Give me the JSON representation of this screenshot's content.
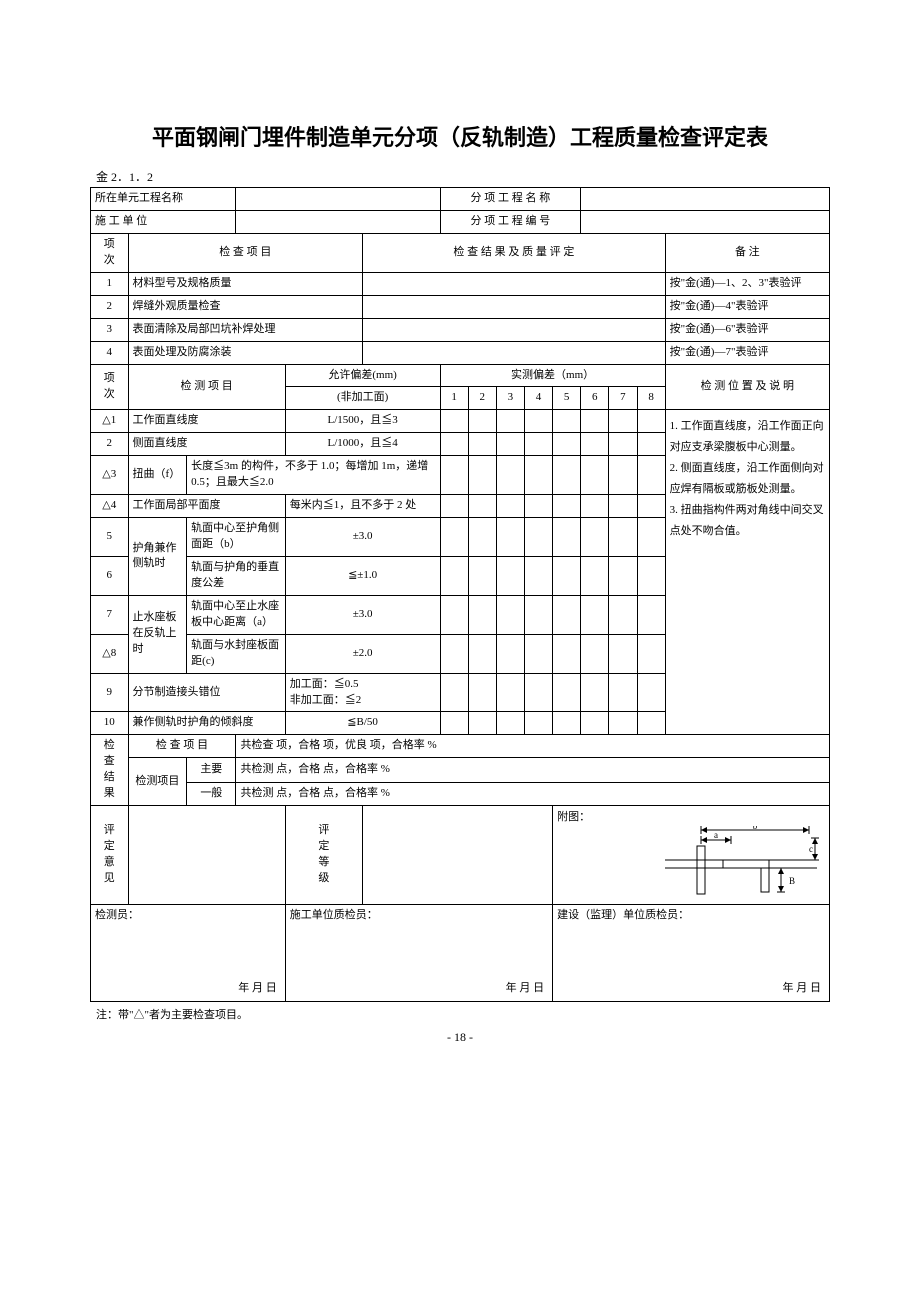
{
  "title": "平面钢闸门埋件制造单元分项（反轨制造）工程质量检查评定表",
  "form_code": "金 2．1．2",
  "hdr": {
    "unit_name_lbl": "所在单元工程名称",
    "sub_name_lbl": "分 项 工 程 名 称",
    "contractor_lbl": "施  工  单  位",
    "sub_no_lbl": "分 项 工 程 编 号",
    "col_idx": "项\n次",
    "col_item": "检  查  项  目",
    "col_result": "检  查  结  果  及  质  量  评  定",
    "col_remark": "备    注"
  },
  "chk": [
    {
      "n": "1",
      "item": "材料型号及规格质量",
      "remark": "按\"金(通)—1、2、3\"表验评"
    },
    {
      "n": "2",
      "item": "焊缝外观质量检查",
      "remark": "按\"金(通)—4\"表验评"
    },
    {
      "n": "3",
      "item": "表面清除及局部凹坑补焊处理",
      "remark": "按\"金(通)—6\"表验评"
    },
    {
      "n": "4",
      "item": "表面处理及防腐涂装",
      "remark": "按\"金(通)—7\"表验评"
    }
  ],
  "meas_hdr": {
    "idx": "项\n次",
    "item": "检  测  项  目",
    "tol": "允许偏差(mm)",
    "tol_sub": "(非加工面)",
    "actual": "实测偏差（mm）",
    "cols": [
      "1",
      "2",
      "3",
      "4",
      "5",
      "6",
      "7",
      "8"
    ],
    "pos": "检 测 位 置 及 说 明"
  },
  "meas": {
    "r1": {
      "n": "△1",
      "item": "工作面直线度",
      "tol": "L/1500，且≦3"
    },
    "r2": {
      "n": "2",
      "item": "侧面直线度",
      "tol": "L/1000，且≦4"
    },
    "r3": {
      "n": "△3",
      "item": "扭曲（f）",
      "tol": "长度≦3m 的构件，不多于 1.0；每增加 1m，递增 0.5；且最大≦2.0"
    },
    "r4": {
      "n": "△4",
      "item": "工作面局部平面度",
      "tol": "每米内≦1，且不多于 2 处"
    },
    "grp56": "护角兼作侧轨时",
    "r5": {
      "n": "5",
      "sub": "轨面中心至护角侧面距（b）",
      "tol": "±3.0"
    },
    "r6": {
      "n": "6",
      "sub": "轨面与护角的垂直度公差",
      "tol": "≦±1.0"
    },
    "grp78": "止水座板在反轨上时",
    "r7": {
      "n": "7",
      "sub": "轨面中心至止水座板中心距离（a）",
      "tol": "±3.0"
    },
    "r8": {
      "n": "△8",
      "sub": "轨面与水封座板面距(c)",
      "tol": "±2.0"
    },
    "r9": {
      "n": "9",
      "item": "分节制造接头错位",
      "tol": "加工面：≦0.5\n非加工面：≦2"
    },
    "r10": {
      "n": "10",
      "item": "兼作侧轨时护角的倾斜度",
      "tol": "≦B/50"
    }
  },
  "pos_notes": "1. 工作面直线度，沿工作面正向对应支承梁腹板中心测量。\n2. 侧面直线度，沿工作面侧向对应焊有隔板或筋板处测量。\n3. 扭曲指构件两对角线中间交叉点处不吻合值。",
  "sum": {
    "block": "检\n查\n结\n果",
    "row1_a": "检 查 项 目",
    "row1_b": "共检查        项，合格        项，优良        项，合格率          %",
    "row2_a": "检测项目",
    "row2_main": "主要",
    "row2_gen": "一般",
    "row2_t": "共检测        点，合格        点，合格率          %",
    "opinion": "评\n定\n意\n见",
    "grade": "评\n定\n等\n级",
    "fig_lbl": "附图："
  },
  "sign": {
    "a": "检测员：",
    "b": "施工单位质检员：",
    "c": "建设（监理）单位质检员：",
    "date": "年    月    日"
  },
  "footnote": "注：带\"△\"者为主要检查项目。",
  "page_no": "- 18 -",
  "fig": {
    "a": "a",
    "b": "b",
    "c": "c",
    "B": "B"
  }
}
